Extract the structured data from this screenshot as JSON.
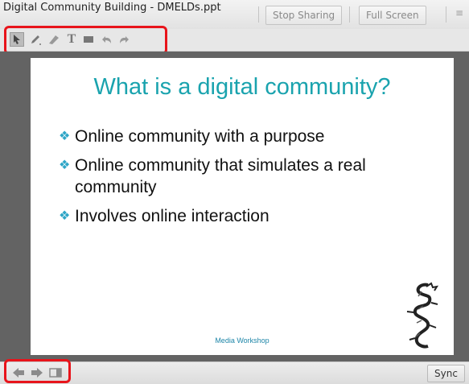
{
  "window": {
    "title": "Digital Community Building - DMELDs.ppt",
    "stop_sharing_label": "Stop Sharing",
    "full_screen_label": "Full Screen",
    "menu_icon": "menu-icon"
  },
  "toolbar": {
    "tools": [
      "pointer-icon",
      "pencil-icon",
      "eraser-icon",
      "text-icon",
      "shape-icon",
      "undo-icon",
      "redo-icon"
    ],
    "text_tool_glyph": "T"
  },
  "slide": {
    "title": "What is a digital community?",
    "bullets": [
      "Online community with a purpose",
      "Online community that simulates a real community",
      "Involves online interaction"
    ],
    "bullet_glyph": "❖",
    "footer": "Media Workshop",
    "title_color": "#1aa3ae",
    "bullet_color": "#2fa6c7"
  },
  "bottom": {
    "icons": [
      "previous-arrow-icon",
      "next-arrow-icon",
      "panel-toggle-icon"
    ],
    "sync_label": "Sync"
  },
  "highlight_color": "#e8141b"
}
